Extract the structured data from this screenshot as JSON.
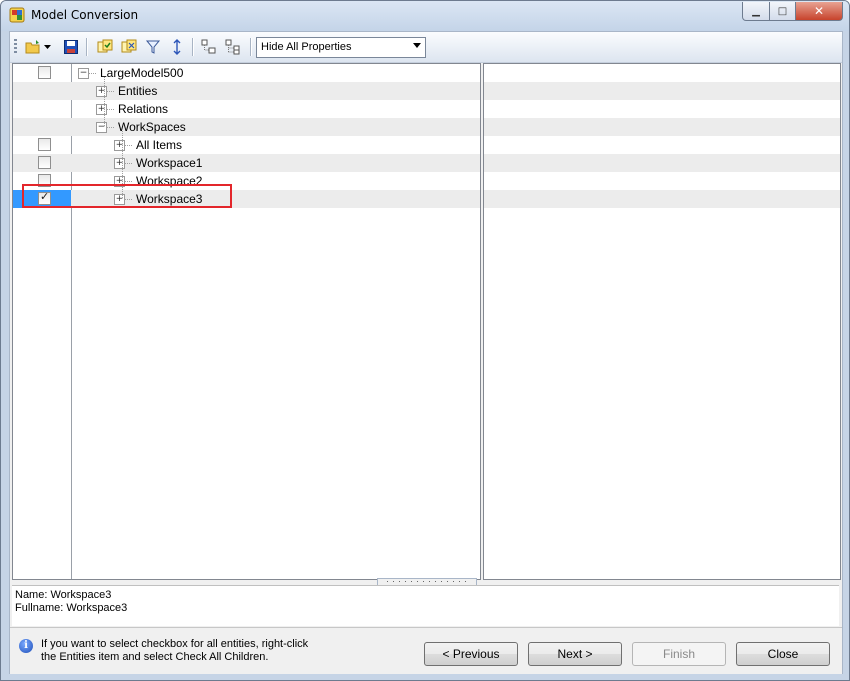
{
  "window": {
    "title": "Model Conversion"
  },
  "toolbar": {
    "properties_dropdown": "Hide All Properties",
    "icons": [
      "open-folder-icon",
      "dropdown-arrow-icon",
      "save-icon",
      "check-children-icon",
      "uncheck-children-icon",
      "filter-icon",
      "sort-icon",
      "expand-all-icon",
      "collapse-all-icon"
    ]
  },
  "tree": {
    "rows": [
      {
        "label": "LargeModel500",
        "checkbox": "unchecked",
        "expander": "−"
      },
      {
        "label": "Entities",
        "checkbox": "none",
        "expander": "+"
      },
      {
        "label": "Relations",
        "checkbox": "none",
        "expander": "+"
      },
      {
        "label": "WorkSpaces",
        "checkbox": "none",
        "expander": "−"
      },
      {
        "label": "All Items",
        "checkbox": "unchecked",
        "expander": "+"
      },
      {
        "label": "Workspace1",
        "checkbox": "unchecked",
        "expander": "+"
      },
      {
        "label": "Workspace2",
        "checkbox": "unchecked",
        "expander": "+"
      },
      {
        "label": "Workspace3",
        "checkbox": "checked",
        "expander": "+",
        "selected": true
      }
    ]
  },
  "details": {
    "name_line": "Name: Workspace3",
    "fullname_line": "Fullname: Workspace3"
  },
  "footer": {
    "hint_line1": "If you want to select checkbox for all entities, right-click",
    "hint_line2": "the Entities item and select Check All Children.",
    "previous_label": "< Previous",
    "next_label": "Next >",
    "finish_label": "Finish",
    "close_label": "Close"
  },
  "colors": {
    "selection": "#3399ff",
    "highlight_border": "#e3262b"
  }
}
